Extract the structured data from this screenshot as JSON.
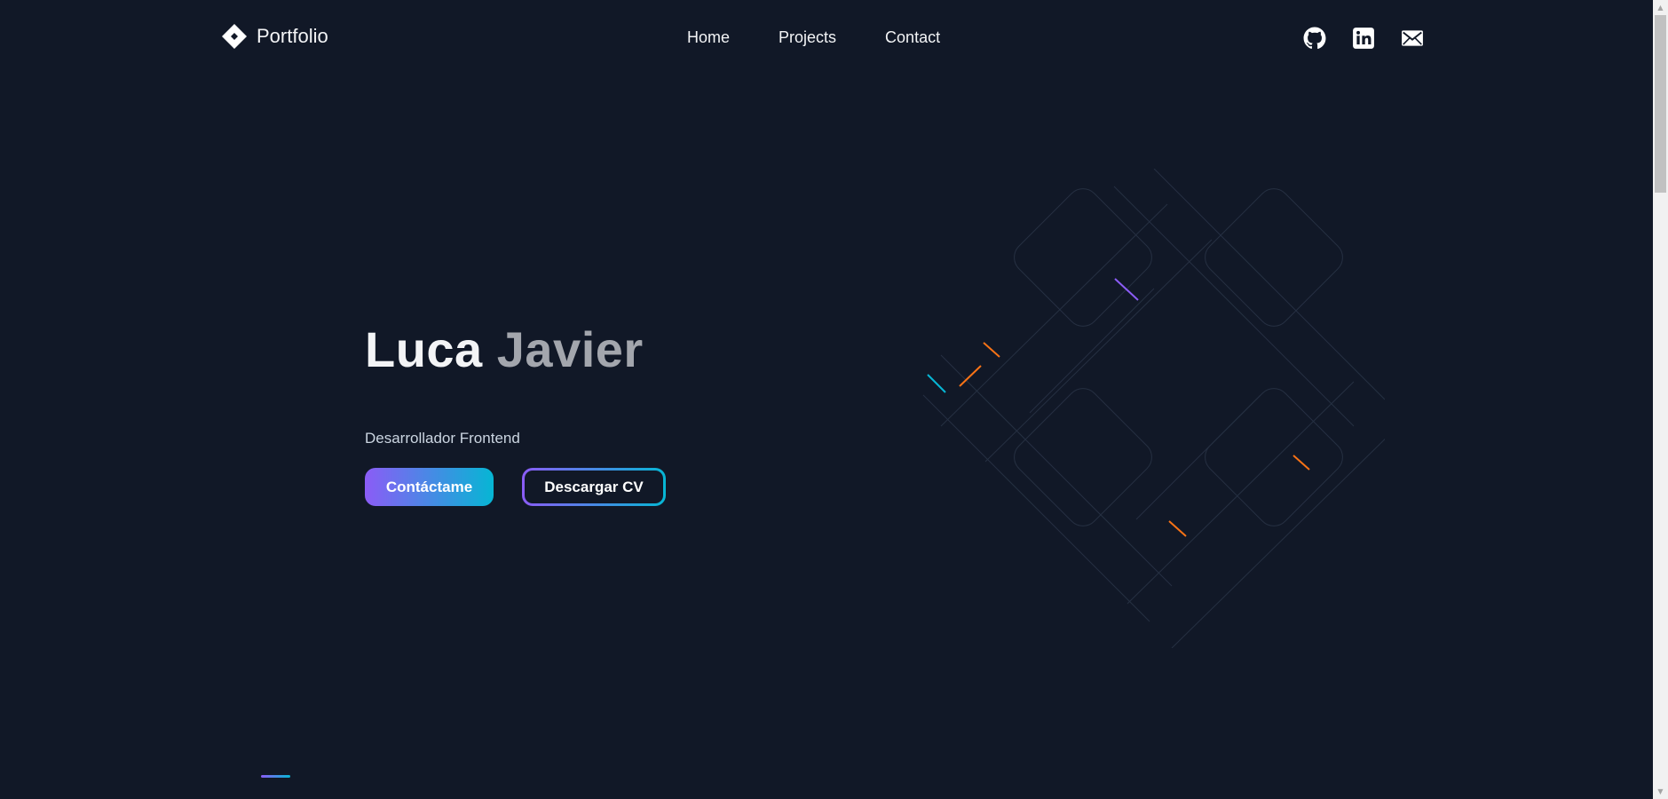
{
  "header": {
    "logo_text": "Portfolio",
    "nav": [
      {
        "label": "Home"
      },
      {
        "label": "Projects"
      },
      {
        "label": "Contact"
      }
    ],
    "socials": [
      {
        "icon": "github-icon"
      },
      {
        "icon": "linkedin-icon"
      },
      {
        "icon": "mail-icon"
      }
    ]
  },
  "hero": {
    "first_name": "Luca",
    "last_name": "Javier",
    "role": "Desarrollador Frontend",
    "primary_button": "Contáctame",
    "secondary_button": "Descargar CV"
  },
  "colors": {
    "background": "#111827",
    "accent_start": "#8b5cf6",
    "accent_end": "#06b6d4",
    "text": "#f3f4f6",
    "muted_text": "#a3a6ad"
  }
}
